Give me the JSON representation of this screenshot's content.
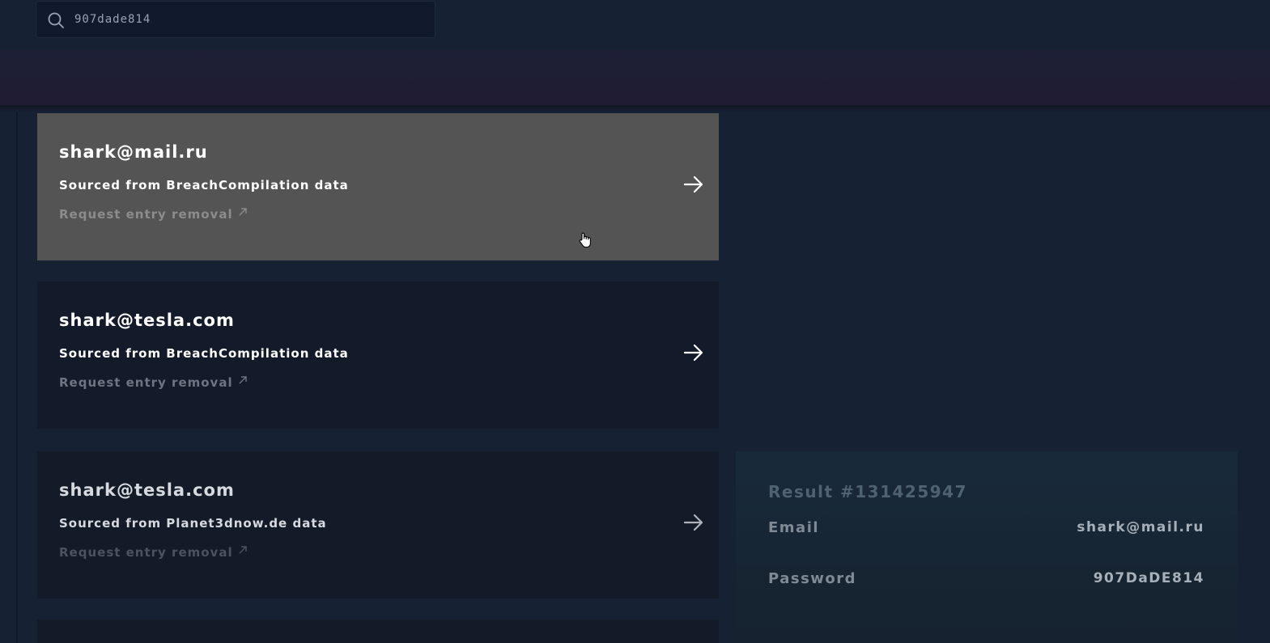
{
  "search": {
    "value": "907dade814",
    "icon": "search-icon"
  },
  "results": [
    {
      "email": "shark@mail.ru",
      "source": "Sourced from BreachCompilation data",
      "removal": "Request entry removal"
    },
    {
      "email": "shark@tesla.com",
      "source": "Sourced from BreachCompilation data",
      "removal": "Request entry removal"
    },
    {
      "email": "shark@tesla.com",
      "source": "Sourced from Planet3dnow.de data",
      "removal": "Request entry removal"
    }
  ],
  "detail": {
    "title": "Result #131425947",
    "email_label": "Email",
    "email_value": "shark@mail.ru",
    "password_label": "Password",
    "password_value": "907DaDE814"
  },
  "colors": {
    "background": "#172134",
    "card": "#131b2a",
    "card_hover": "#545454",
    "banner": "#1e1e35",
    "detail_panel": "#182a3a"
  }
}
